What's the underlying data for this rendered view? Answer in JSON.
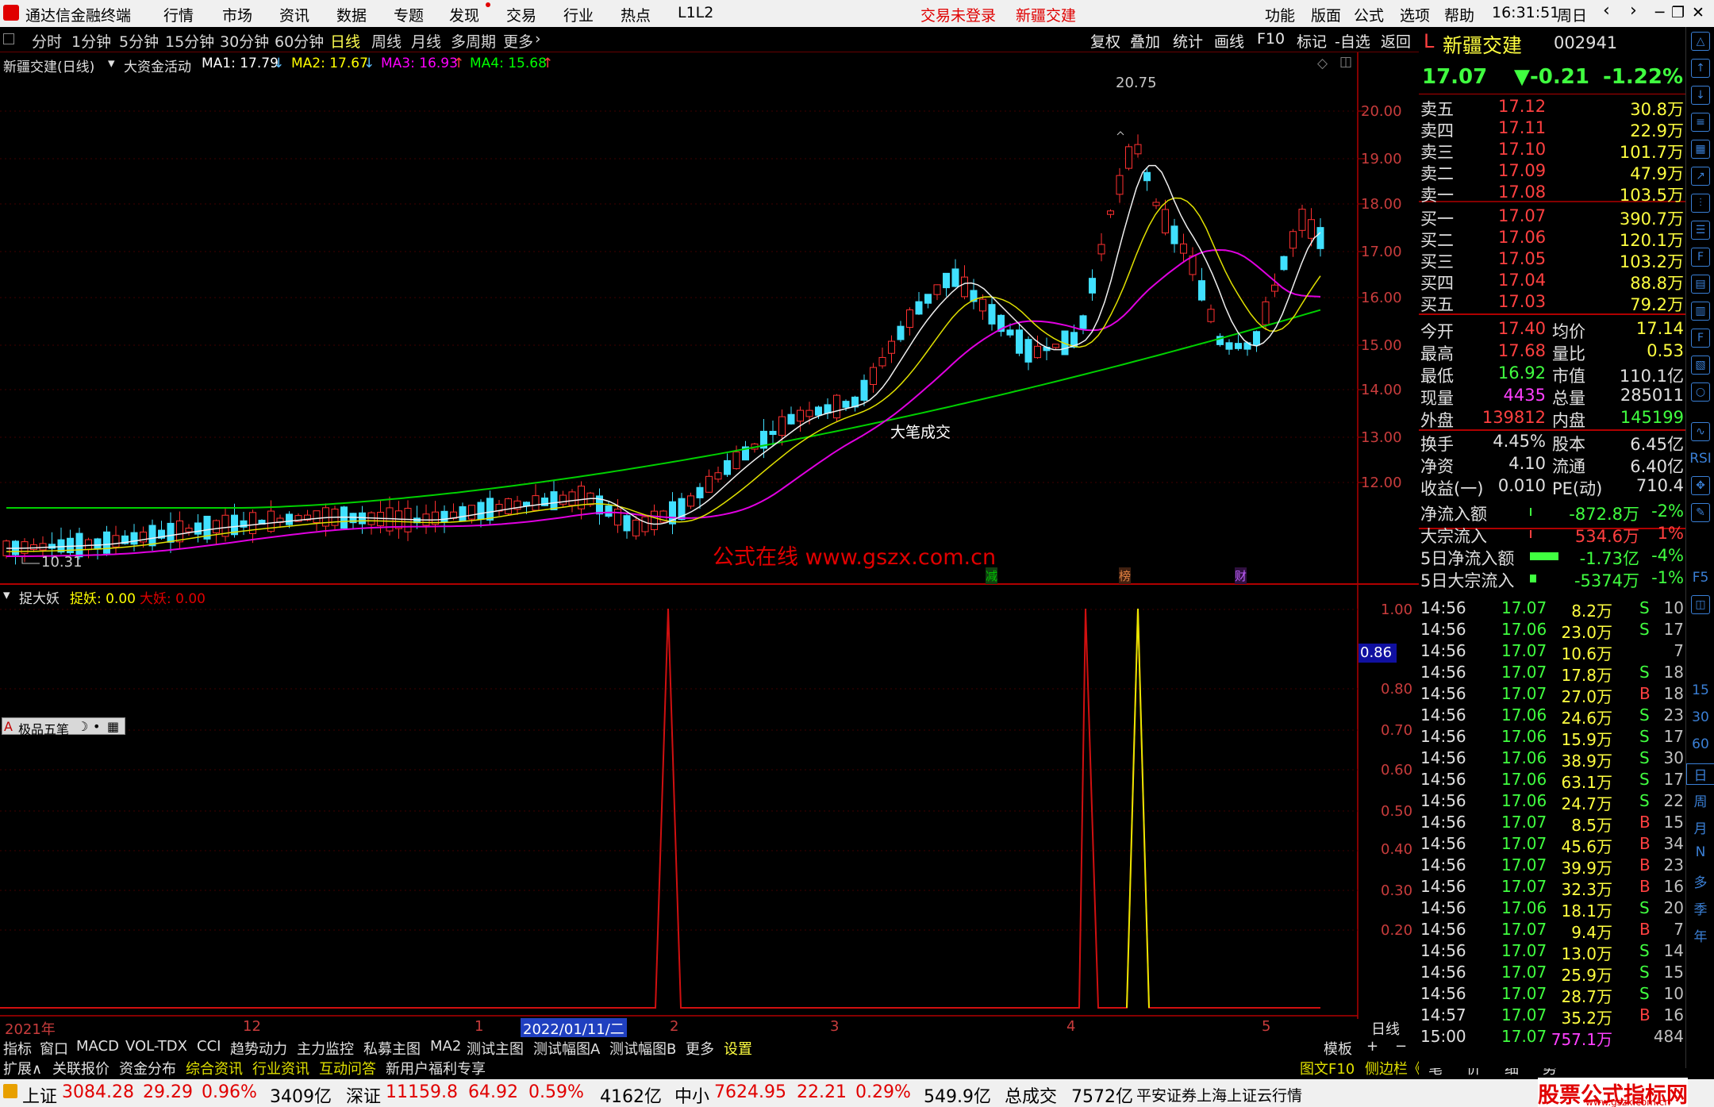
{
  "app": {
    "title": "通达信金融终端",
    "menu": [
      "行情",
      "市场",
      "资讯",
      "数据",
      "专题",
      "发现",
      "交易",
      "行业",
      "热点",
      "L1L2"
    ],
    "login_status": "交易未登录",
    "stock_tab": "新疆交建",
    "right_menu": [
      "功能",
      "版面",
      "公式",
      "选项",
      "帮助"
    ],
    "time": "16:31:51",
    "weekday": "周日"
  },
  "toolbar": {
    "periods": [
      "分时",
      "1分钟",
      "5分钟",
      "15分钟",
      "30分钟",
      "60分钟",
      "日线",
      "周线",
      "月线",
      "多周期",
      "更多"
    ],
    "active_period": "日线",
    "right_buttons": [
      "复权",
      "叠加",
      "统计",
      "画线",
      "F10",
      "标记",
      "-自选",
      "返回"
    ]
  },
  "main_chart": {
    "title": "新疆交建(日线)",
    "indicator_name": "大资金活动",
    "ma": [
      {
        "label": "MA1: 17.79",
        "color": "#ffffff"
      },
      {
        "label": "MA2: 17.67",
        "color": "#ffff00"
      },
      {
        "label": "MA3: 16.93",
        "color": "#ff00ff"
      },
      {
        "label": "MA4: 15.68",
        "color": "#00ff00"
      }
    ],
    "high_label": "20.75",
    "low_label": "10.31",
    "annotation": "大笔成交",
    "watermark": "公式在线   www.gszx.com.cn",
    "yticks": [
      "20.00",
      "19.00",
      "18.00",
      "17.00",
      "16.00",
      "15.00",
      "14.00",
      "13.00",
      "12.00"
    ],
    "event_marks": [
      {
        "text": "减",
        "color": "#00c000"
      },
      {
        "text": "榜",
        "color": "#e08040"
      },
      {
        "text": "财",
        "color": "#c060ff"
      }
    ]
  },
  "sub_chart": {
    "title": "捉大妖",
    "label1": "捉妖: 0.00",
    "label2": "大妖: 0.00",
    "yticks": [
      "1.00",
      "0.80",
      "0.70",
      "0.60",
      "0.50",
      "0.40",
      "0.30",
      "0.20"
    ],
    "cursor_value": "0.86",
    "drawing_toolbar": "极品五笔"
  },
  "x_axis": {
    "labels": [
      "2021年",
      "12",
      "1",
      "2022/01/11/二",
      "2",
      "3",
      "4",
      "5"
    ],
    "period_label": "日线"
  },
  "indicator_tabs": [
    "指标",
    "窗口",
    "MACD",
    "VOL-TDX",
    "CCI",
    "趋势动力",
    "主力监控",
    "私募主图",
    "MA2",
    "测试主图",
    "测试幅图A",
    "测试幅图B",
    "更多",
    "设置"
  ],
  "indicator_tabs_right": [
    "模板",
    "+",
    "−"
  ],
  "info_tabs": [
    "扩展∧",
    "关联报价",
    "资金分布",
    "综合资讯",
    "行业资讯",
    "互动问答",
    "新用户福利专享"
  ],
  "info_tabs_right": [
    "图文F10",
    "侧边栏《",
    "笔",
    "价",
    "细",
    "势"
  ],
  "quote": {
    "name": "新疆交建",
    "code": "002941",
    "price": "17.07",
    "change": "▼-0.21",
    "pct": "-1.22%",
    "sell": [
      {
        "label": "卖五",
        "price": "17.12",
        "vol": "30.8万"
      },
      {
        "label": "卖四",
        "price": "17.11",
        "vol": "22.9万"
      },
      {
        "label": "卖三",
        "price": "17.10",
        "vol": "101.7万"
      },
      {
        "label": "卖二",
        "price": "17.09",
        "vol": "47.9万"
      },
      {
        "label": "卖一",
        "price": "17.08",
        "vol": "103.5万"
      }
    ],
    "buy": [
      {
        "label": "买一",
        "price": "17.07",
        "vol": "390.7万"
      },
      {
        "label": "买二",
        "price": "17.06",
        "vol": "120.1万"
      },
      {
        "label": "买三",
        "price": "17.05",
        "vol": "103.2万"
      },
      {
        "label": "买四",
        "price": "17.04",
        "vol": "88.8万"
      },
      {
        "label": "买五",
        "price": "17.03",
        "vol": "79.2万"
      }
    ],
    "stats": [
      {
        "l1": "今开",
        "v1": "17.40",
        "c1": "#ff4040",
        "l2": "均价",
        "v2": "17.14",
        "c2": "#ffff40"
      },
      {
        "l1": "最高",
        "v1": "17.68",
        "c1": "#ff4040",
        "l2": "量比",
        "v2": "0.53",
        "c2": "#ffff40"
      },
      {
        "l1": "最低",
        "v1": "16.92",
        "c1": "#40ff40",
        "l2": "市值",
        "v2": "110.1亿",
        "c2": "#e0e0e0"
      },
      {
        "l1": "现量",
        "v1": "4435",
        "c1": "#ff40ff",
        "l2": "总量",
        "v2": "285011",
        "c2": "#e0e0e0"
      },
      {
        "l1": "外盘",
        "v1": "139812",
        "c1": "#ff4040",
        "l2": "内盘",
        "v2": "145199",
        "c2": "#40ff40"
      }
    ],
    "stats2": [
      {
        "l1": "换手",
        "v1": "4.45%",
        "l2": "股本",
        "v2": "6.45亿"
      },
      {
        "l1": "净资",
        "v1": "4.10",
        "l2": "流通",
        "v2": "6.40亿"
      },
      {
        "l1": "收益(一)",
        "v1": "0.010",
        "l2": "PE(动)",
        "v2": "710.4"
      }
    ],
    "flows": [
      {
        "label": "净流入额",
        "value": "-872.8万",
        "pct": "-2%",
        "color": "#40ff40"
      },
      {
        "label": "大宗流入",
        "value": "534.6万",
        "pct": "1%",
        "color": "#ff4040"
      },
      {
        "label": "5日净流入额",
        "value": "-1.73亿",
        "pct": "-4%",
        "color": "#40ff40"
      },
      {
        "label": "5日大宗流入",
        "value": "-5374万",
        "pct": "-1%",
        "color": "#40ff40"
      }
    ],
    "ticks": [
      [
        "14:56",
        "17.07",
        "8.2万",
        "S",
        "10"
      ],
      [
        "14:56",
        "17.06",
        "23.0万",
        "S",
        "17"
      ],
      [
        "14:56",
        "17.07",
        "10.6万",
        "",
        "7"
      ],
      [
        "14:56",
        "17.07",
        "17.8万",
        "S",
        "18"
      ],
      [
        "14:56",
        "17.07",
        "27.0万",
        "B",
        "18"
      ],
      [
        "14:56",
        "17.06",
        "24.6万",
        "S",
        "23"
      ],
      [
        "14:56",
        "17.06",
        "15.9万",
        "S",
        "17"
      ],
      [
        "14:56",
        "17.06",
        "38.9万",
        "S",
        "30"
      ],
      [
        "14:56",
        "17.06",
        "63.1万",
        "S",
        "17"
      ],
      [
        "14:56",
        "17.06",
        "24.7万",
        "S",
        "22"
      ],
      [
        "14:56",
        "17.07",
        "8.5万",
        "B",
        "15"
      ],
      [
        "14:56",
        "17.07",
        "45.6万",
        "B",
        "34"
      ],
      [
        "14:56",
        "17.07",
        "39.9万",
        "B",
        "23"
      ],
      [
        "14:56",
        "17.07",
        "32.3万",
        "B",
        "16"
      ],
      [
        "14:56",
        "17.06",
        "18.1万",
        "S",
        "20"
      ],
      [
        "14:56",
        "17.07",
        "9.4万",
        "B",
        "7"
      ],
      [
        "14:56",
        "17.07",
        "13.0万",
        "S",
        "14"
      ],
      [
        "14:56",
        "17.07",
        "25.9万",
        "S",
        "15"
      ],
      [
        "14:56",
        "17.07",
        "28.7万",
        "S",
        "10"
      ],
      [
        "14:57",
        "17.07",
        "35.2万",
        "B",
        "16"
      ],
      [
        "15:00",
        "17.07",
        "757.1万",
        "",
        "484"
      ]
    ]
  },
  "sidebar_labels": [
    "RSI",
    "F5",
    "15",
    "30",
    "60",
    "日",
    "周",
    "月",
    "N",
    "多",
    "季",
    "年"
  ],
  "status_bar": {
    "items": [
      {
        "name": "上证",
        "value": "3084.28",
        "chg": "29.29",
        "pct": "0.96%",
        "amt": "3409亿"
      },
      {
        "name": "深证",
        "value": "11159.8",
        "chg": "64.92",
        "pct": "0.59%",
        "amt": "4162亿"
      },
      {
        "name": "中小",
        "value": "7624.95",
        "chg": "22.21",
        "pct": "0.29%",
        "amt": "549.9亿"
      }
    ],
    "total_label": "总成交",
    "total_value": "7572亿",
    "broker": "平安证券上海上证云行情",
    "logo_text": "股票公式指标网",
    "logo_url": "www.gszx.com.cn"
  }
}
